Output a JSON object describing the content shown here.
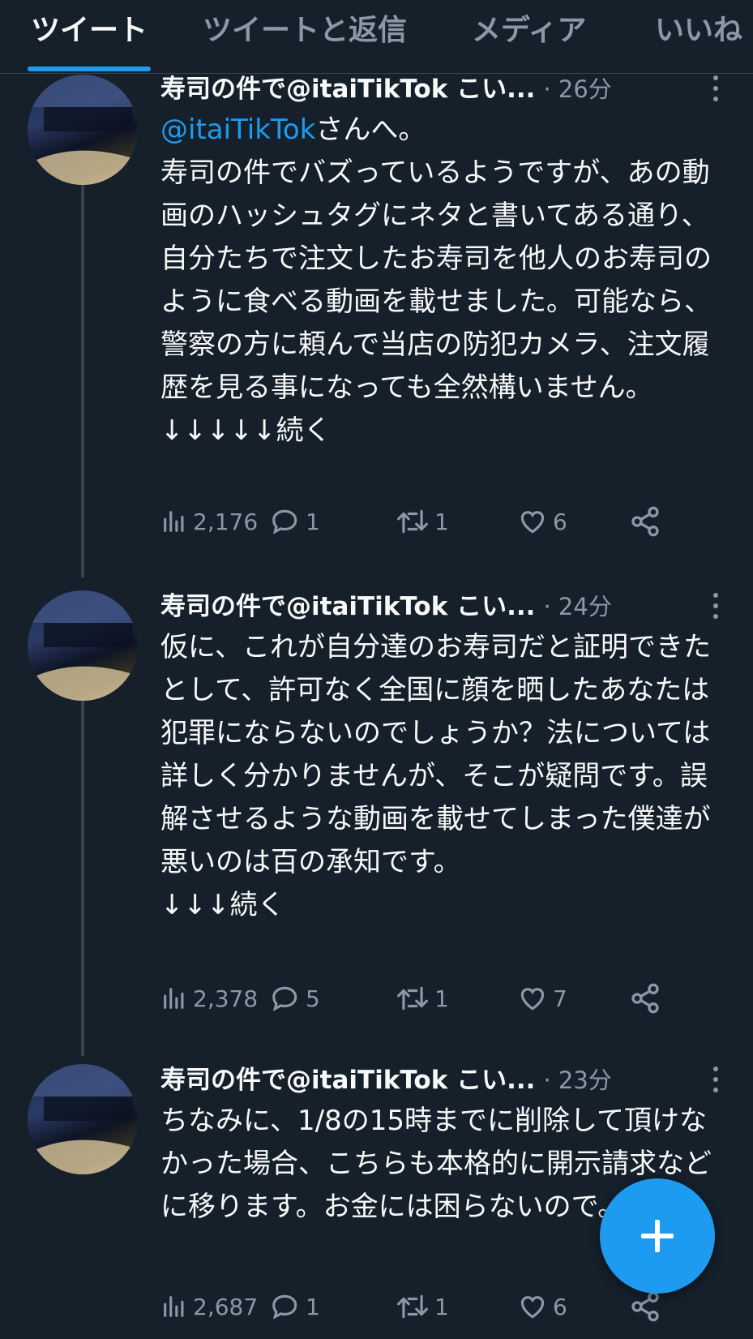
{
  "tabs": [
    {
      "label": "ツイート",
      "active": true
    },
    {
      "label": "ツイートと返信",
      "active": false
    },
    {
      "label": "メディア",
      "active": false
    },
    {
      "label": "いいね",
      "active": false
    }
  ],
  "colors": {
    "accent": "#1d9bf0",
    "background": "#15202b",
    "muted": "#8b98a5"
  },
  "tweets": [
    {
      "name": "寿司の件で@itaiTikTok こい...",
      "time": "· 26分",
      "mention": "@itaiTikTok",
      "text_after_mention": "さんへ。",
      "text": "寿司の件でバズっているようですが、あの動画のハッシュタグにネタと書いてある通り、自分たちで注文したお寿司を他人のお寿司のように食べる動画を載せました。可能なら、警察の方に頼んで当店の防犯カメラ、注文履歴を見る事になっても全然構いません。\n↓↓↓↓↓続く",
      "views": "2,176",
      "replies": "1",
      "retweets": "1",
      "likes": "6"
    },
    {
      "name": "寿司の件で@itaiTikTok こい...",
      "time": "· 24分",
      "text": "仮に、これが自分達のお寿司だと証明できたとして、許可なく全国に顔を晒したあなたは犯罪にならないのでしょうか？法については詳しく分かりませんが、そこが疑問です。誤解させるような動画を載せてしまった僕達が悪いのは百の承知です。\n↓↓↓続く",
      "views": "2,378",
      "replies": "5",
      "retweets": "1",
      "likes": "7"
    },
    {
      "name": "寿司の件で@itaiTikTok こい...",
      "time": "· 23分",
      "text": "ちなみに、1/8の15時までに削除して頂けなかった場合、こちらも本格的に開示請求などに移ります。お金には困らないので。",
      "views": "2,687",
      "replies": "1",
      "retweets": "1",
      "likes": "6"
    }
  ],
  "fab_icon": "plus-icon"
}
